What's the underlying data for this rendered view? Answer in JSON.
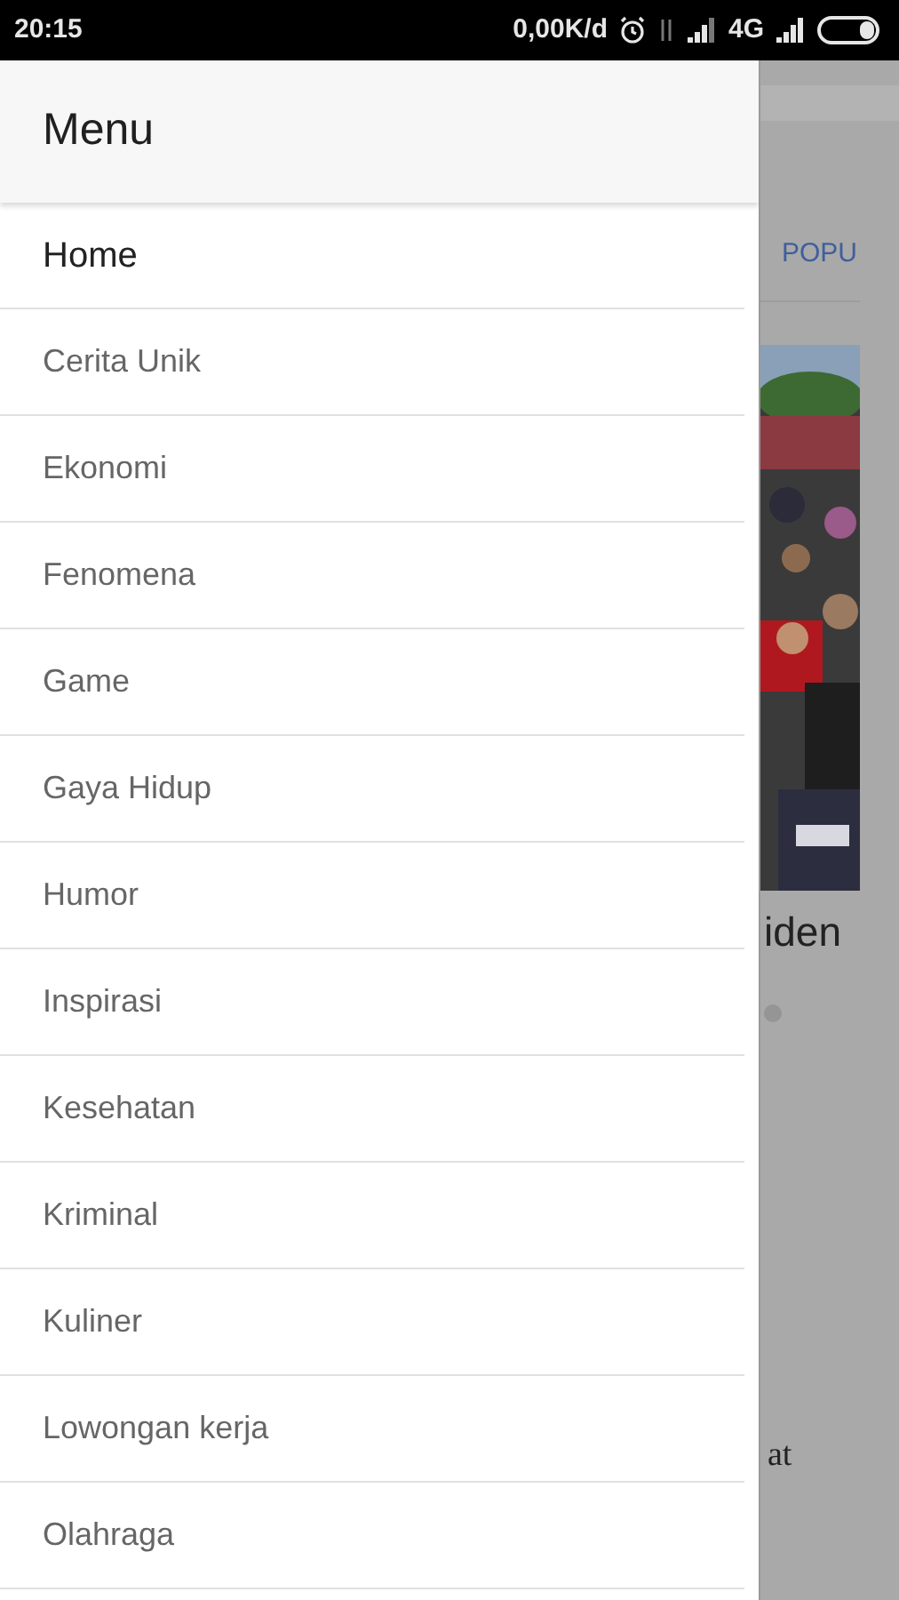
{
  "status_bar": {
    "time": "20:15",
    "speed": "0,00K/d",
    "network": "4G"
  },
  "drawer": {
    "title": "Menu",
    "items": [
      {
        "label": "Home",
        "selected": true
      },
      {
        "label": "Cerita Unik",
        "selected": false
      },
      {
        "label": "Ekonomi",
        "selected": false
      },
      {
        "label": "Fenomena",
        "selected": false
      },
      {
        "label": "Game",
        "selected": false
      },
      {
        "label": "Gaya Hidup",
        "selected": false
      },
      {
        "label": "Humor",
        "selected": false
      },
      {
        "label": "Inspirasi",
        "selected": false
      },
      {
        "label": "Kesehatan",
        "selected": false
      },
      {
        "label": "Kriminal",
        "selected": false
      },
      {
        "label": "Kuliner",
        "selected": false
      },
      {
        "label": "Lowongan kerja",
        "selected": false
      },
      {
        "label": "Olahraga",
        "selected": false
      }
    ]
  },
  "background": {
    "tab": "POPU",
    "headline": "iden",
    "snippet": "at"
  }
}
